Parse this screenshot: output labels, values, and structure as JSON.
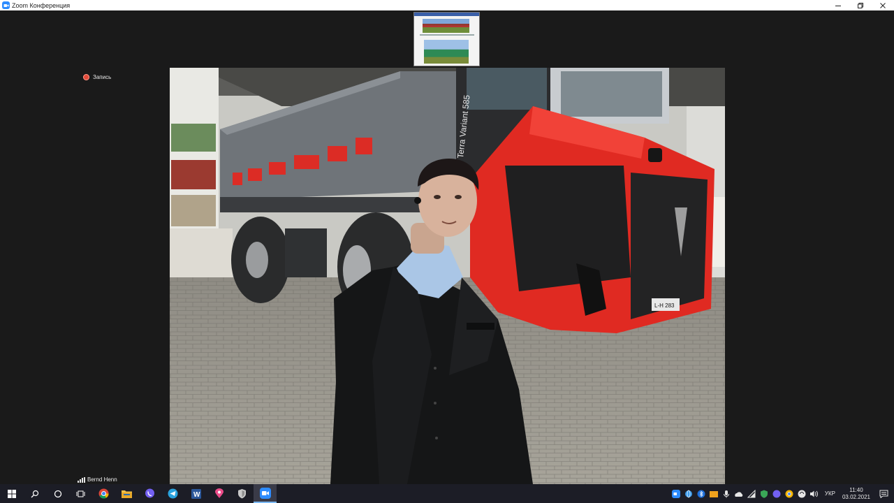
{
  "window": {
    "title": "Zoom Конференция",
    "controls": [
      "minimize-icon",
      "restore-icon",
      "close-icon"
    ]
  },
  "recording": {
    "label": "Запись",
    "color": "#e04a3a"
  },
  "screen_share_thumbnail": {
    "visible": true
  },
  "video": {
    "participant_name": "Bernd Henn",
    "truck_model_text": "Terra Variant 585",
    "plate_text": "L-H 283"
  },
  "taskbar": {
    "apps": [
      {
        "name": "windows-start-icon"
      },
      {
        "name": "search-icon"
      },
      {
        "name": "cortana-icon"
      },
      {
        "name": "task-view-icon"
      },
      {
        "name": "chrome-icon"
      },
      {
        "name": "file-explorer-icon"
      },
      {
        "name": "viber-icon"
      },
      {
        "name": "telegram-icon"
      },
      {
        "name": "word-icon"
      },
      {
        "name": "maps-pin-icon"
      },
      {
        "name": "shield-app-icon"
      },
      {
        "name": "zoom-icon",
        "active": true
      }
    ],
    "tray_icons": [
      "zoom-tray-icon",
      "globe-icon",
      "bluetooth-icon",
      "folder-tray-icon",
      "microphone-icon",
      "onedrive-icon",
      "network-icon",
      "defender-icon",
      "viber-tray-icon",
      "chrome-tray-icon",
      "sync-icon",
      "speaker-icon"
    ],
    "language": "УКР",
    "time": "11:40",
    "date": "03.02.2021",
    "accent": "#7bb8f4"
  },
  "colors": {
    "tractor_red": "#e02a22",
    "trailer_gray": "#6f7479",
    "background": "#1a1a1a"
  }
}
